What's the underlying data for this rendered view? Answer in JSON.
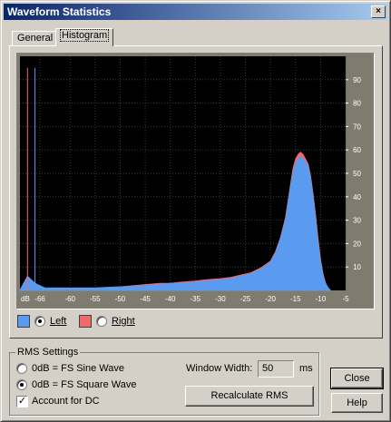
{
  "window": {
    "title": "Waveform Statistics",
    "close_glyph": "×"
  },
  "tabs": [
    {
      "label": "General",
      "active": false
    },
    {
      "label": "Histogram",
      "active": true
    }
  ],
  "chart_data": {
    "type": "area",
    "xlabel": "dB",
    "x_ticks": [
      "-66",
      "-60",
      "-55",
      "-50",
      "-45",
      "-40",
      "-35",
      "-30",
      "-25",
      "-20",
      "-15",
      "-10",
      "-5"
    ],
    "y_ticks": [
      "10",
      "20",
      "30",
      "40",
      "50",
      "60",
      "70",
      "80",
      "90"
    ],
    "ylim": [
      0,
      100
    ],
    "xlim": [
      -70,
      -5
    ],
    "grid": true,
    "series": [
      {
        "name": "Left",
        "color": "#5b9bef",
        "x": [
          -70,
          -68.5,
          -67,
          -65,
          -60,
          -55,
          -50,
          -45,
          -42,
          -40,
          -38,
          -35,
          -33,
          -30,
          -28,
          -26,
          -24,
          -22,
          -20,
          -19,
          -18,
          -17,
          -16.5,
          -16,
          -15.5,
          -15,
          -14.5,
          -14,
          -13.5,
          -13,
          -12.5,
          -12,
          -11.5,
          -11,
          -10.5,
          -10,
          -9.5,
          -9,
          -8.5,
          -8
        ],
        "y": [
          0,
          6,
          3,
          1,
          1,
          1,
          1.5,
          2,
          2.5,
          3,
          3,
          3.5,
          4,
          4.5,
          5,
          6,
          7,
          9,
          12,
          16,
          22,
          30,
          37,
          44,
          50,
          54,
          56,
          57,
          56,
          55,
          53,
          48,
          40,
          30,
          20,
          12,
          6,
          3,
          1,
          0
        ]
      },
      {
        "name": "Right",
        "color": "#ef6b6b",
        "x": [
          -70,
          -68.5,
          -67,
          -65,
          -60,
          -55,
          -50,
          -45,
          -42,
          -40,
          -38,
          -35,
          -33,
          -30,
          -28,
          -26,
          -24,
          -22,
          -20,
          -19,
          -18,
          -17,
          -16.5,
          -16,
          -15.5,
          -15,
          -14.5,
          -14,
          -13.5,
          -13,
          -12.5,
          -12,
          -11.5,
          -11,
          -10.5,
          -10,
          -9.5,
          -9,
          -8.5,
          -8
        ],
        "y": [
          0,
          6,
          3,
          1,
          1,
          1,
          1.5,
          2.5,
          3,
          3,
          3.5,
          4,
          4.5,
          5,
          5.5,
          6.5,
          7.5,
          9.5,
          12.5,
          16.5,
          22.5,
          31,
          38,
          45,
          52,
          56,
          58,
          59,
          58,
          56,
          54,
          49,
          41,
          32,
          22,
          13,
          7,
          3,
          1,
          0
        ]
      }
    ],
    "spikes": [
      {
        "x": -68.5,
        "y": 95,
        "color": "#ef6b6b"
      },
      {
        "x": -67,
        "y": 95,
        "color": "#5b9bef"
      }
    ]
  },
  "legend": {
    "left": {
      "label": "Left",
      "color": "#5b9bef",
      "selected": true
    },
    "right": {
      "label": "Right",
      "color": "#ef6b6b",
      "selected": false
    }
  },
  "rms": {
    "group_title": "RMS Settings",
    "sine_label": "0dB = FS Sine Wave",
    "square_label": "0dB = FS Square Wave",
    "square_selected": true,
    "dc_label": "Account for DC",
    "dc_checked": true,
    "window_width_label": "Window Width:",
    "window_width_value": "50",
    "window_width_unit": "ms",
    "recalc_label": "Recalculate RMS"
  },
  "buttons": {
    "close": "Close",
    "help": "Help"
  }
}
